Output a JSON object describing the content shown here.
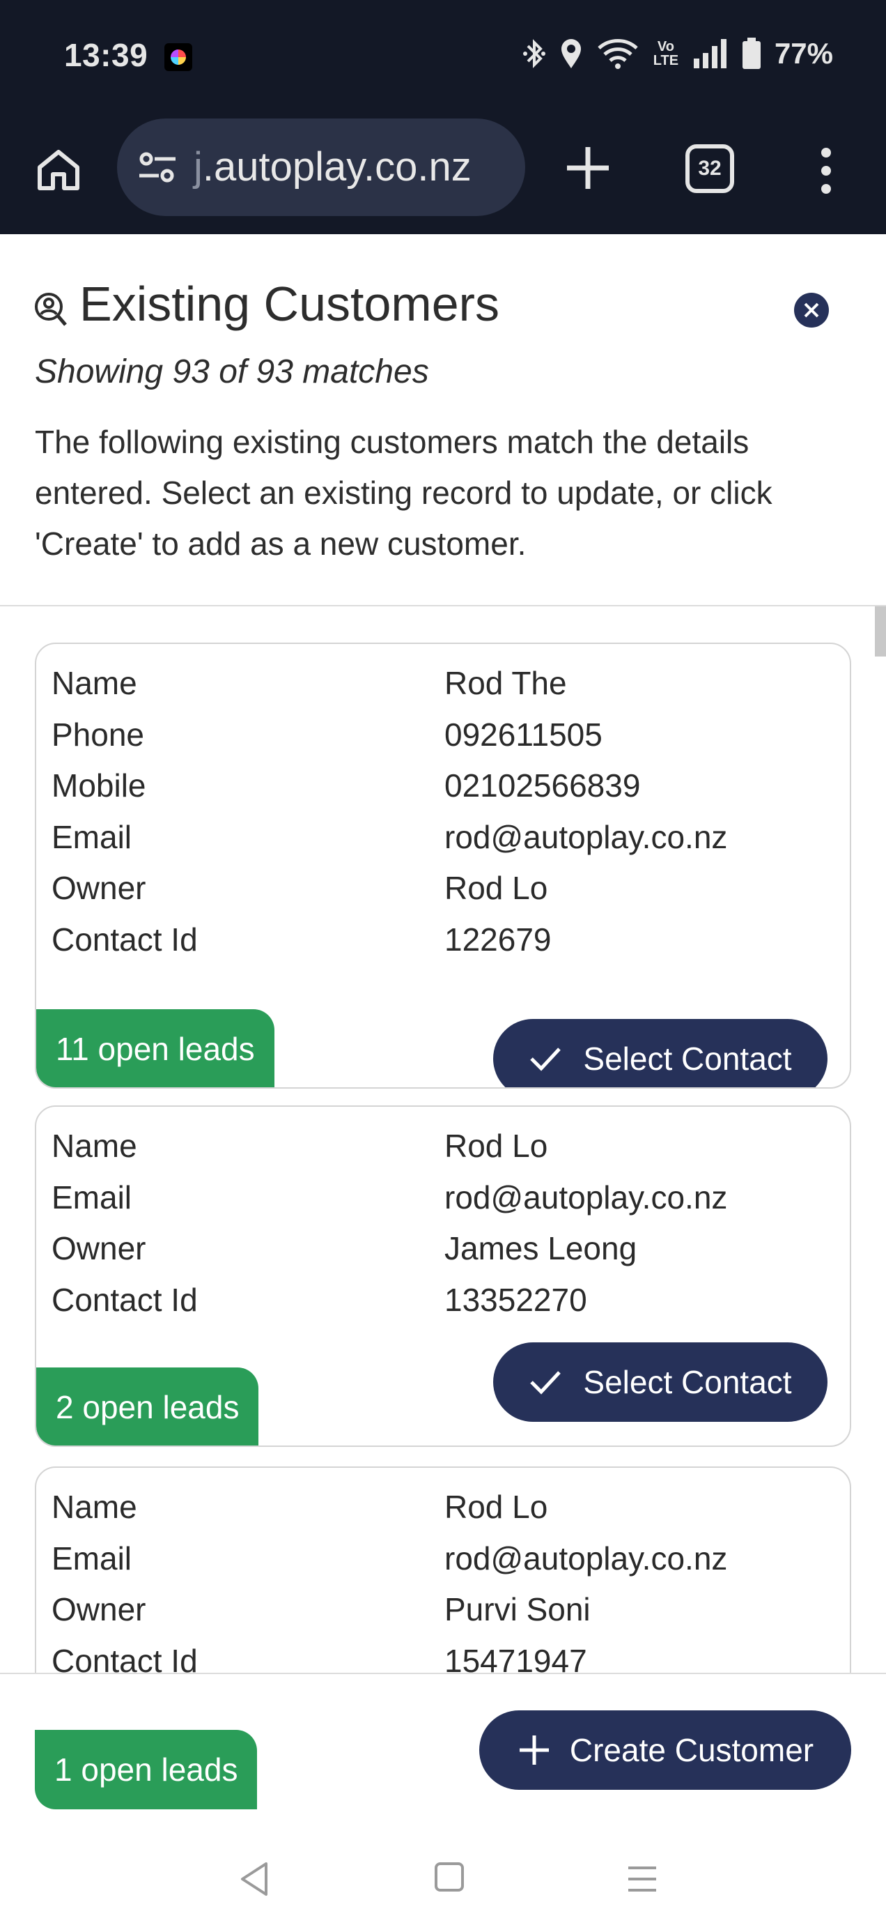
{
  "status_bar": {
    "time": "13:39",
    "volte": "Vo\nLTE",
    "battery": "77%"
  },
  "browser": {
    "url_prefix": "",
    "url_text": ".autoplay.co.nz",
    "url_fade": "j",
    "tab_count": "32"
  },
  "modal": {
    "title": "Existing Customers",
    "subtitle": "Showing 93 of 93 matches",
    "description": "The following existing customers match the details entered. Select an existing record to update, or click 'Create' to add as a new customer."
  },
  "labels": {
    "name": "Name",
    "phone": "Phone",
    "mobile": "Mobile",
    "email": "Email",
    "owner": "Owner",
    "contact_id": "Contact Id",
    "select_contact": "Select Contact",
    "create_customer": "Create Customer"
  },
  "customers": [
    {
      "name": "Rod The",
      "phone": "092611505",
      "mobile": "02102566839",
      "email": "rod@autoplay.co.nz",
      "owner": "Rod Lo",
      "contact_id": "122679",
      "open_leads": "11 open leads"
    },
    {
      "name": "Rod Lo",
      "email": "rod@autoplay.co.nz",
      "owner": "James Leong",
      "contact_id": "13352270",
      "open_leads": "2 open leads"
    },
    {
      "name": "Rod Lo",
      "email": "rod@autoplay.co.nz",
      "owner": "Purvi Soni",
      "contact_id": "15471947",
      "open_leads": "1 open leads"
    }
  ],
  "colors": {
    "chrome_bg": "#131826",
    "primary": "#263159",
    "leads_green": "#2a9d58"
  }
}
